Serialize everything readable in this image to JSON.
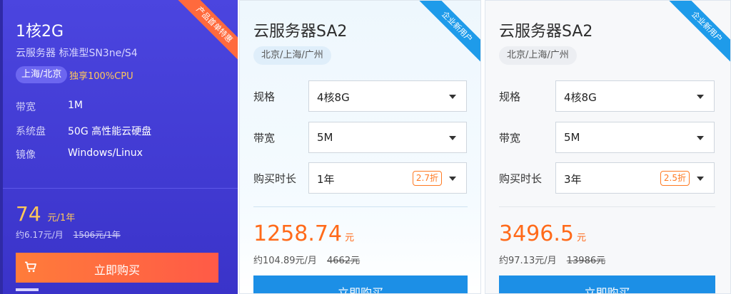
{
  "colors": {
    "card1_bg": "#4b45df",
    "accent_orange": "#ff6a1a",
    "accent_yellow": "#ffc85a",
    "buy_blue": "#1c8fe6",
    "ribbon_blue": "#1e9bea",
    "ribbon_orange": "#ff6a3d"
  },
  "card1": {
    "ribbon": "产品首单特惠",
    "title": "1核2G",
    "subtitle": "云服务器 标准型SN3ne/S4",
    "region": "上海/北京",
    "cpu_note": "独享100%CPU",
    "specs": [
      {
        "label": "带宽",
        "value": "1M"
      },
      {
        "label": "系统盘",
        "value": "50G 高性能云硬盘"
      },
      {
        "label": "镜像",
        "value": "Windows/Linux"
      }
    ],
    "price": "74",
    "price_unit": "元/1年",
    "monthly": "约6.17元/月",
    "original": "1506元/1年",
    "buy_label": "立即购买",
    "cart_icon": "cart-icon"
  },
  "card2": {
    "ribbon": "企业新用户",
    "title": "云服务器SA2",
    "region": "北京/上海/广州",
    "fields": {
      "spec": {
        "label": "规格",
        "value": "4核8G"
      },
      "bandwidth": {
        "label": "带宽",
        "value": "5M"
      },
      "duration": {
        "label": "购买时长",
        "value": "1年",
        "discount": "2.7折"
      }
    },
    "price": "1258.74",
    "price_unit": "元",
    "monthly": "约104.89元/月",
    "original": "4662元",
    "buy_label": "立即购买"
  },
  "card3": {
    "ribbon": "企业新用户",
    "title": "云服务器SA2",
    "region": "北京/上海/广州",
    "fields": {
      "spec": {
        "label": "规格",
        "value": "4核8G"
      },
      "bandwidth": {
        "label": "带宽",
        "value": "5M"
      },
      "duration": {
        "label": "购买时长",
        "value": "3年",
        "discount": "2.5折"
      }
    },
    "price": "3496.5",
    "price_unit": "元",
    "monthly": "约97.13元/月",
    "original": "13986元",
    "buy_label": "立即购买"
  }
}
